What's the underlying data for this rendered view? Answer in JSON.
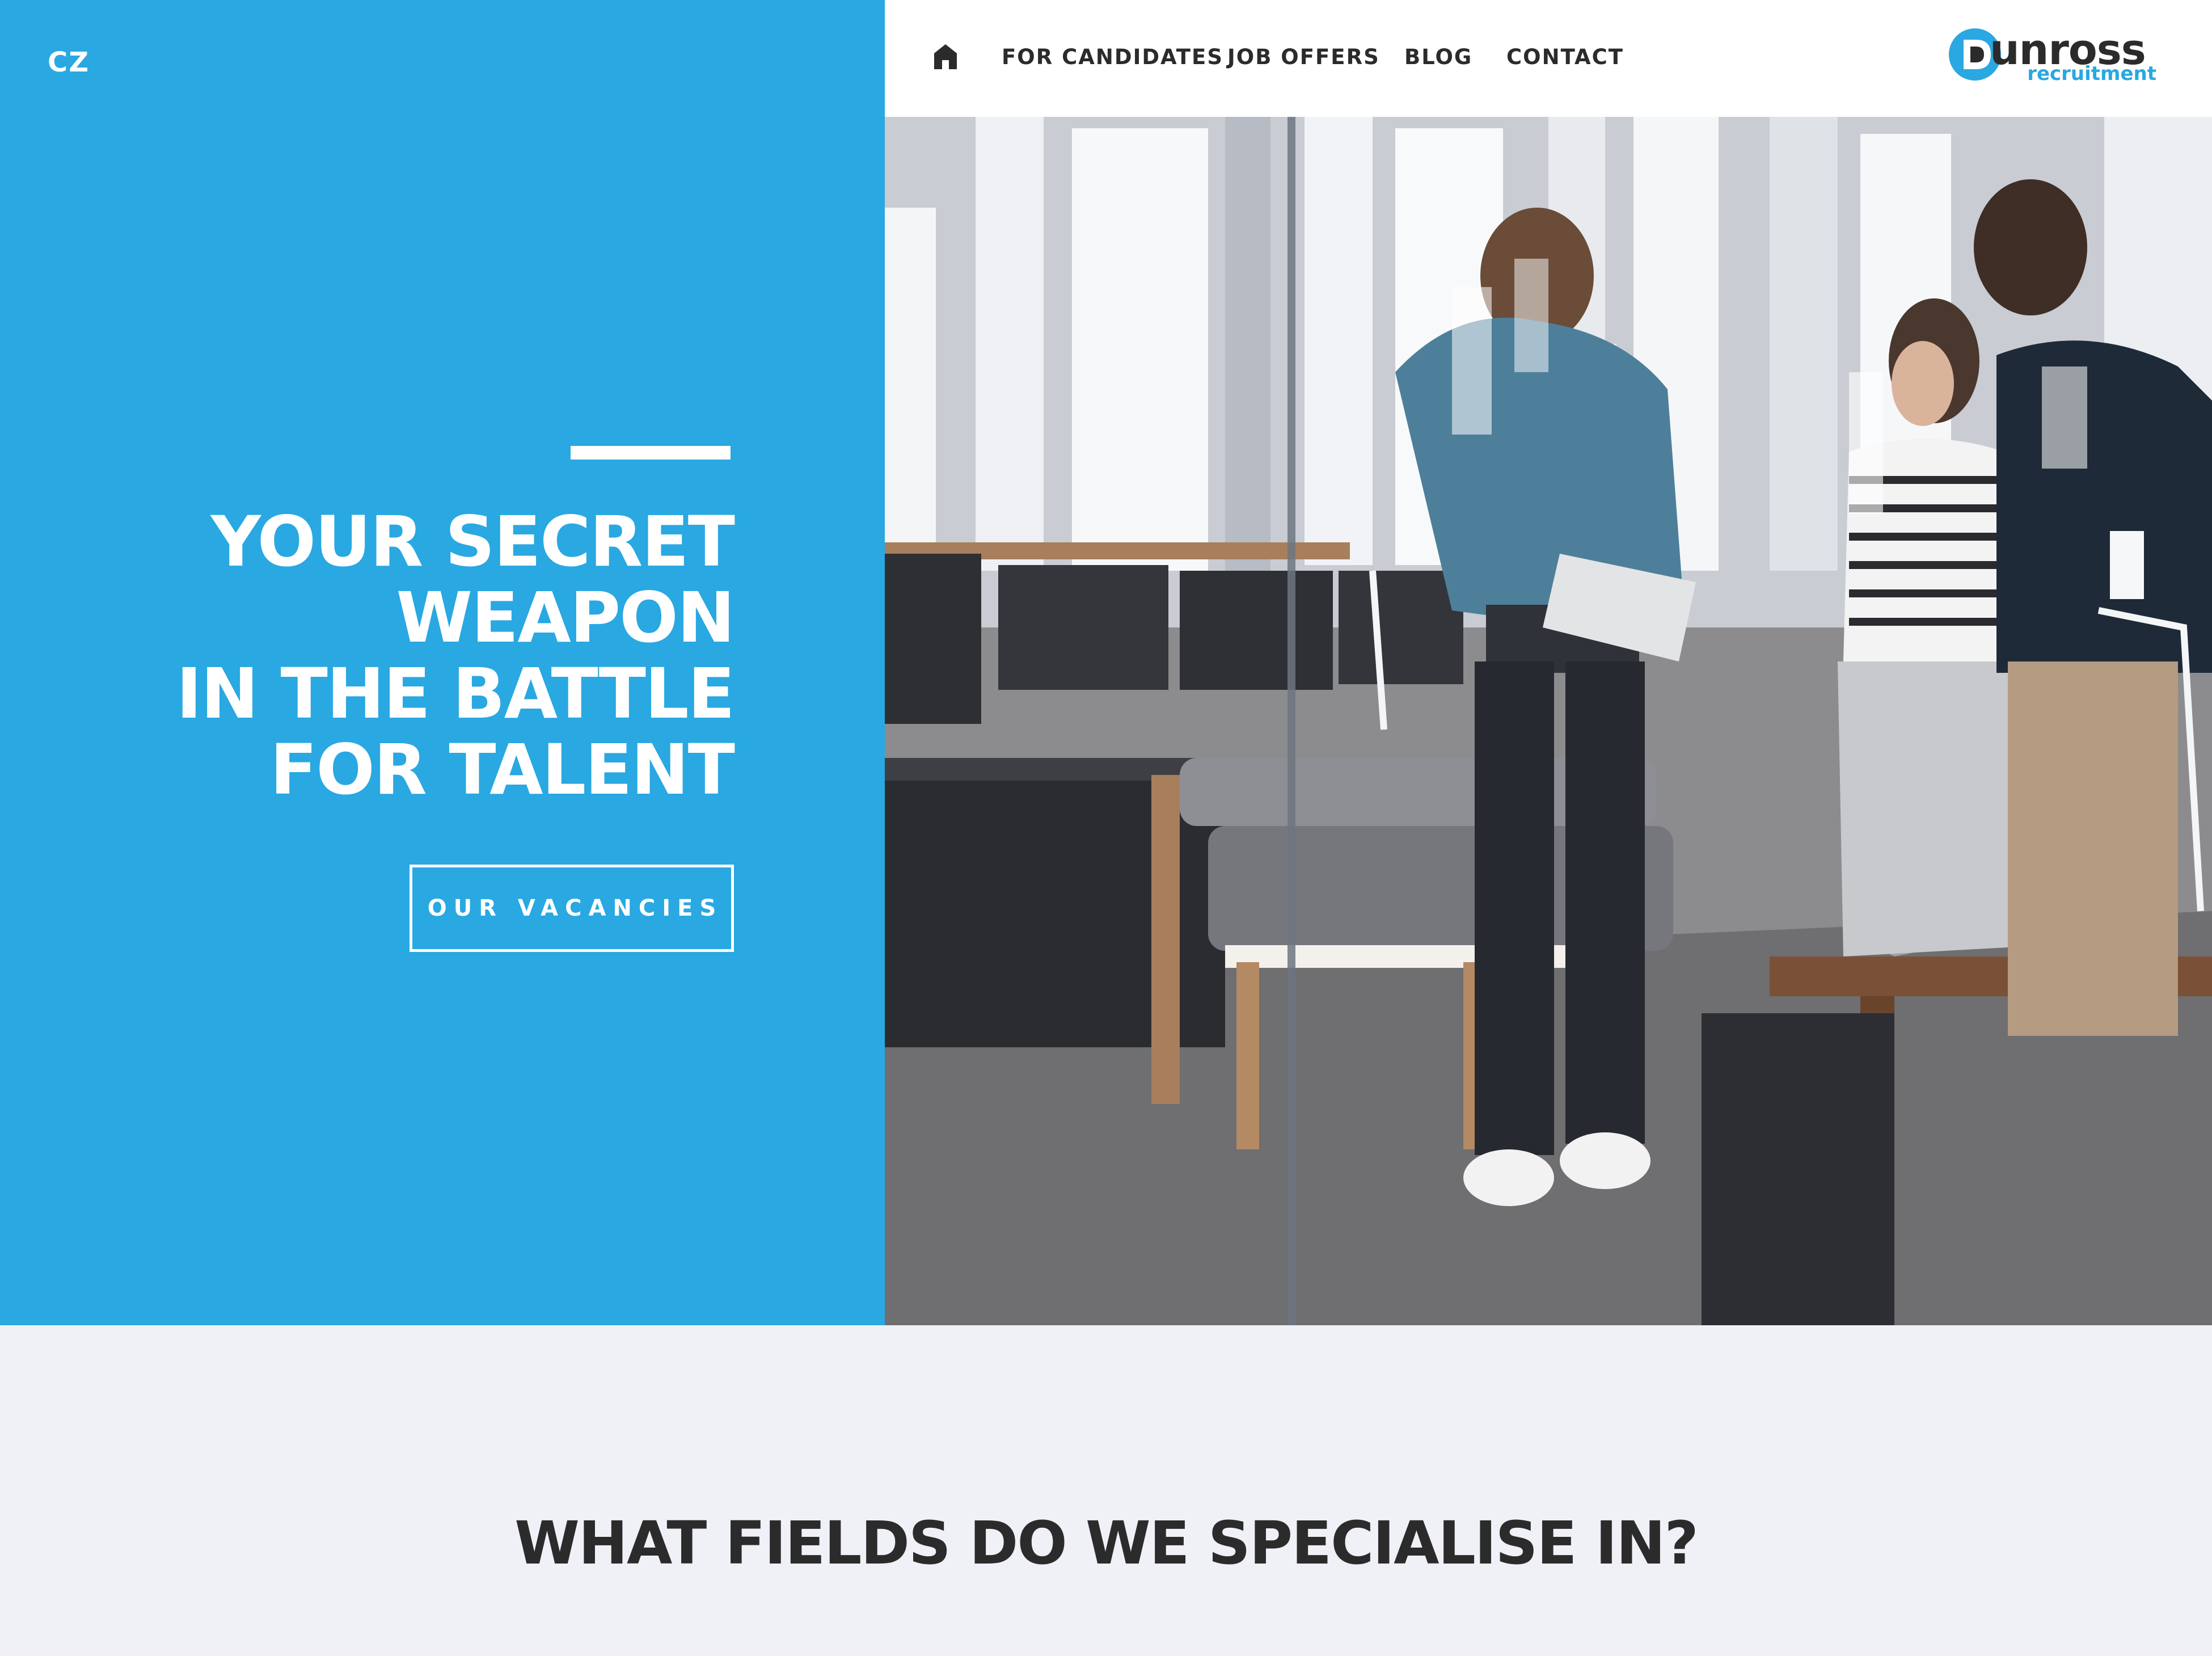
{
  "language_switch": "CZ",
  "nav": {
    "home": "home-icon",
    "items": [
      "FOR CANDIDATES",
      "JOB OFFERS",
      "BLOG",
      "CONTACT"
    ]
  },
  "logo": {
    "brand": "unross",
    "sub": "recruitment"
  },
  "hero": {
    "title_lines": [
      "YOUR SECRET",
      "WEAPON",
      "IN THE BATTLE",
      "FOR TALENT"
    ],
    "cta": "OUR VACANCIES",
    "photo": "office-team-photo"
  },
  "section": {
    "title": "WHAT FIELDS DO WE SPECIALISE IN?"
  },
  "colors": {
    "accent": "#29a8e2",
    "text_dark": "#2b2b2b",
    "background": "#eff1f6"
  }
}
